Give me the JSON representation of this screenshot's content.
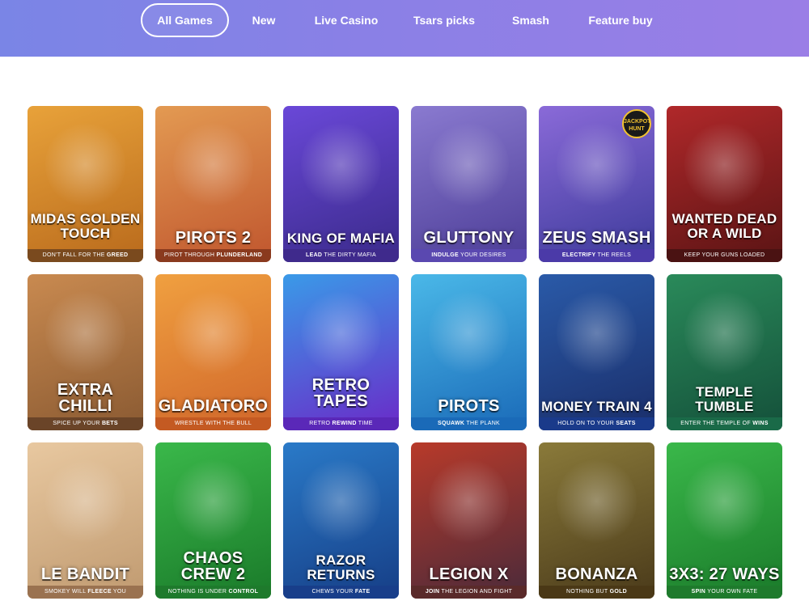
{
  "nav": {
    "tabs": [
      {
        "label": "All Games",
        "active": true
      },
      {
        "label": "New"
      },
      {
        "label": "Live Casino"
      },
      {
        "label": "Tsars picks"
      },
      {
        "label": "Smash"
      },
      {
        "label": "Feature buy"
      }
    ]
  },
  "games": [
    {
      "title": "MIDAS GOLDEN TOUCH",
      "tag_pre": "DON'T FALL FOR THE ",
      "tag_bold": "GREED",
      "tag_post": "",
      "colors": [
        "#e8a23a",
        "#b96a1c"
      ],
      "band": "#7a4a1e"
    },
    {
      "title": "PIROTS 2",
      "tag_pre": "PIROT THROUGH ",
      "tag_bold": "PLUNDERLAND",
      "tag_post": "",
      "colors": [
        "#e39a52",
        "#c0562e"
      ],
      "band": "#8a3a1e"
    },
    {
      "title": "KING OF MAFIA",
      "tag_pre": "",
      "tag_bold": "LEAD",
      "tag_post": " THE DIRTY MAFIA",
      "colors": [
        "#6a48d8",
        "#3a2a8a"
      ],
      "band": "#3f2a8c"
    },
    {
      "title": "GLUTTONY",
      "tag_pre": "",
      "tag_bold": "INDULGE",
      "tag_post": " YOUR DESIRES",
      "colors": [
        "#8a7ad0",
        "#4b3c96"
      ],
      "band": "#5a48b0"
    },
    {
      "title": "ZEUS SMASH",
      "tag_pre": "",
      "tag_bold": "ELECTRIFY",
      "tag_post": " THE REELS",
      "colors": [
        "#8a6ad8",
        "#3c3a9a"
      ],
      "band": "#4b3aa8",
      "badge": "JACKPOT HUNT"
    },
    {
      "title": "WANTED DEAD OR A WILD",
      "tag_pre": "KEEP YOUR GUNS LOADED",
      "tag_bold": "",
      "tag_post": "",
      "colors": [
        "#b0282a",
        "#5a1414"
      ],
      "band": "#4a1212"
    },
    {
      "title": "EXTRA CHILLI",
      "tag_pre": "SPICE UP YOUR ",
      "tag_bold": "BETS",
      "tag_post": "",
      "colors": [
        "#c98a50",
        "#8a5a32"
      ],
      "band": "#6a4428"
    },
    {
      "title": "GLADIATORO",
      "tag_pre": "WRESTLE WITH THE BULL",
      "tag_bold": "",
      "tag_post": "",
      "colors": [
        "#f0a040",
        "#d0662a"
      ],
      "band": "#c45a22"
    },
    {
      "title": "RETRO TAPES",
      "tag_pre": "RETRO ",
      "tag_bold": "REWIND",
      "tag_post": " TIME",
      "colors": [
        "#3a9ae8",
        "#6a2ac8"
      ],
      "band": "#5a28b8"
    },
    {
      "title": "PIROTS",
      "tag_pre": "",
      "tag_bold": "SQUAWK",
      "tag_post": " THE PLANK",
      "colors": [
        "#4ab8e8",
        "#1a6ab8"
      ],
      "band": "#1a6ab8"
    },
    {
      "title": "MONEY TRAIN 4",
      "tag_pre": "HOLD ON TO YOUR ",
      "tag_bold": "SEATS",
      "tag_post": "",
      "colors": [
        "#2a5aa8",
        "#1a2e6a"
      ],
      "band": "#1a3a8a"
    },
    {
      "title": "TEMPLE TUMBLE",
      "tag_pre": "ENTER THE TEMPLE OF ",
      "tag_bold": "WINS",
      "tag_post": "",
      "colors": [
        "#2a8a5a",
        "#14503a"
      ],
      "band": "#1a6a48"
    },
    {
      "title": "LE BANDIT",
      "tag_pre": "SMOKEY WILL ",
      "tag_bold": "FLEECE",
      "tag_post": " YOU",
      "colors": [
        "#e8c8a0",
        "#c09a70"
      ],
      "band": "#9a7250"
    },
    {
      "title": "CHAOS CREW 2",
      "tag_pre": "NOTHING IS UNDER ",
      "tag_bold": "CONTROL",
      "tag_post": "",
      "colors": [
        "#3ab84a",
        "#1a7a2a"
      ],
      "band": "#1e7a2c"
    },
    {
      "title": "RAZOR RETURNS",
      "tag_pre": "CHEWS YOUR ",
      "tag_bold": "FATE",
      "tag_post": "",
      "colors": [
        "#2a7ac8",
        "#163e86"
      ],
      "band": "#183e8a"
    },
    {
      "title": "LEGION X",
      "tag_pre": "",
      "tag_bold": "JOIN",
      "tag_post": " THE LEGION AND FIGHT",
      "colors": [
        "#b83a2a",
        "#4a2a3a"
      ],
      "band": "#5a2a2a"
    },
    {
      "title": "BONANZA",
      "tag_pre": "NOTHING BUT ",
      "tag_bold": "GOLD",
      "tag_post": "",
      "colors": [
        "#8a7a3a",
        "#4a3a1a"
      ],
      "band": "#4a3816"
    },
    {
      "title": "3X3: 27 WAYS",
      "tag_pre": "",
      "tag_bold": "SPIN",
      "tag_post": " YOUR OWN FATE",
      "colors": [
        "#3ab84a",
        "#1a7a2a"
      ],
      "band": "#1e7a2c"
    }
  ]
}
